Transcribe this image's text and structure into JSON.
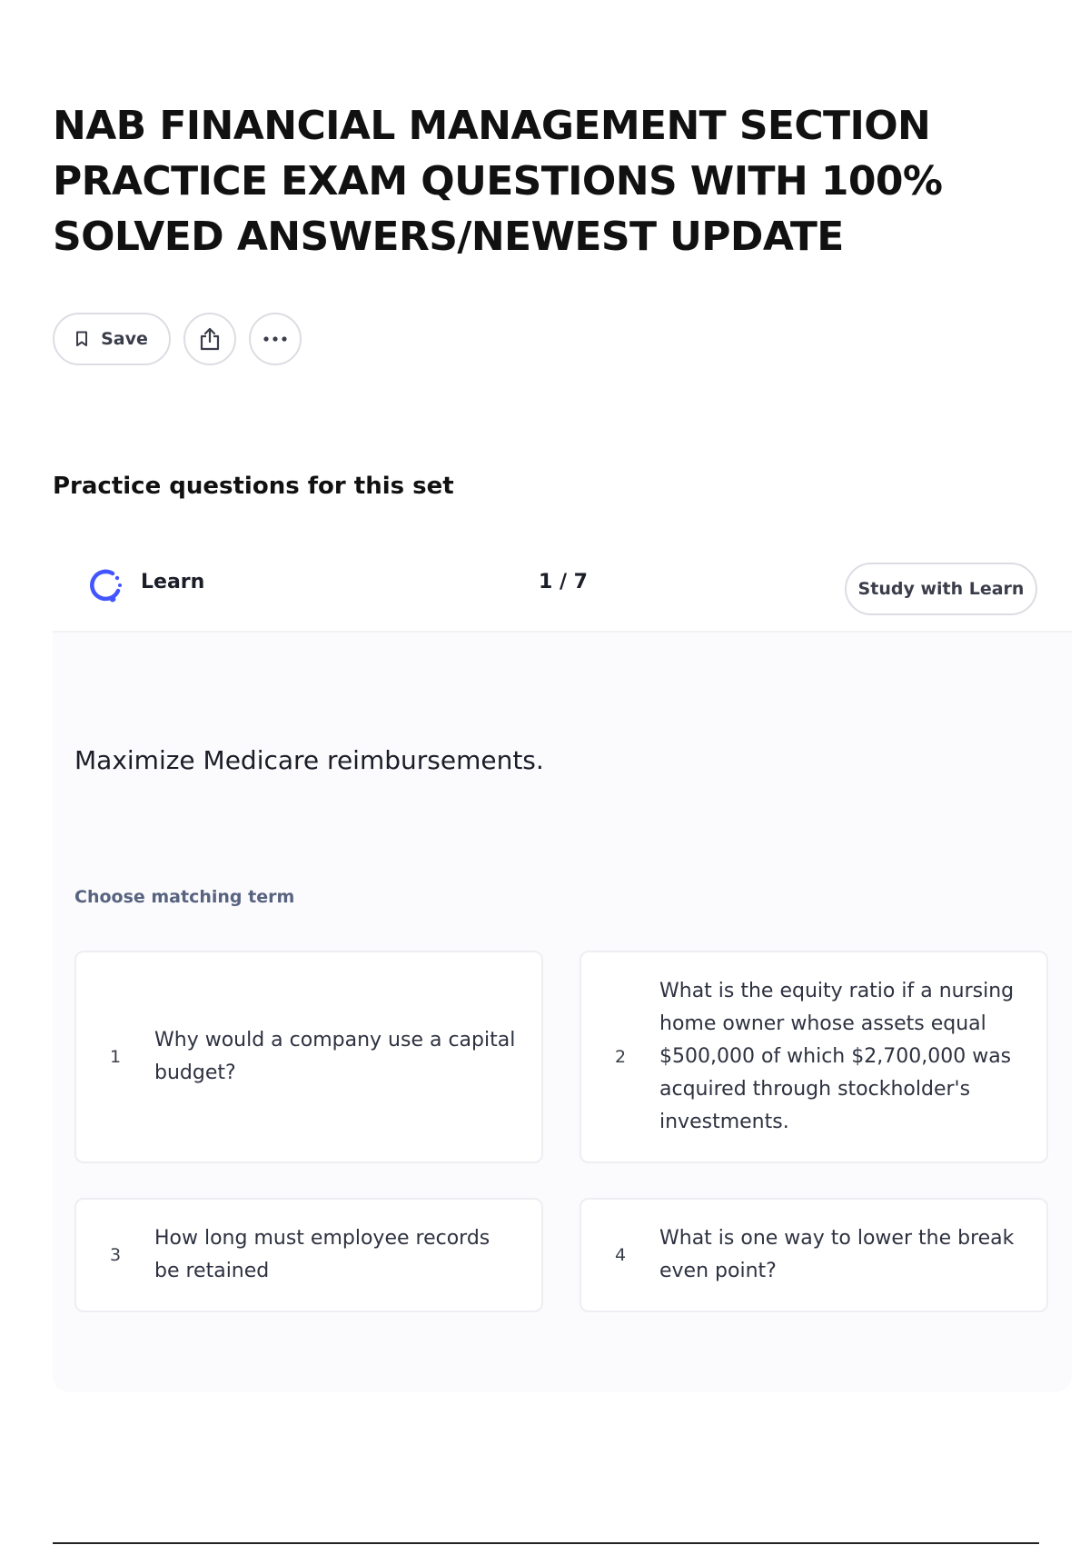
{
  "page": {
    "title": "NAB FINANCIAL MANAGEMENT SECTION PRACTICE EXAM QUESTIONS WITH 100% SOLVED ANSWERS/NEWEST UPDATE"
  },
  "actions": {
    "save_label": "Save",
    "save_icon": "bookmark-icon",
    "share_icon": "share-icon",
    "more_icon": "more-horizontal-icon"
  },
  "practice": {
    "heading": "Practice questions for this set",
    "card": {
      "mode_label": "Learn",
      "mode_icon": "learn-progress-icon",
      "progress": "1 / 7",
      "study_button": "Study with Learn",
      "prompt": "Maximize Medicare reimbursements.",
      "instruction": "Choose matching term",
      "options": [
        {
          "number": "1",
          "text": "Why would a company use a capital budget?"
        },
        {
          "number": "2",
          "text": "What is the equity ratio if a nursing home owner whose assets equal $500,000 of which $2,700,000 was acquired through stockholder's investments."
        },
        {
          "number": "3",
          "text": "How long must employee records be retained"
        },
        {
          "number": "4",
          "text": "What is one way to lower the break even point?"
        }
      ]
    }
  },
  "colors": {
    "accent": "#4255ff",
    "heading_text": "#111111",
    "muted_text": "#586380",
    "border": "#dcdde3",
    "card_background": "#fbfbfd"
  }
}
